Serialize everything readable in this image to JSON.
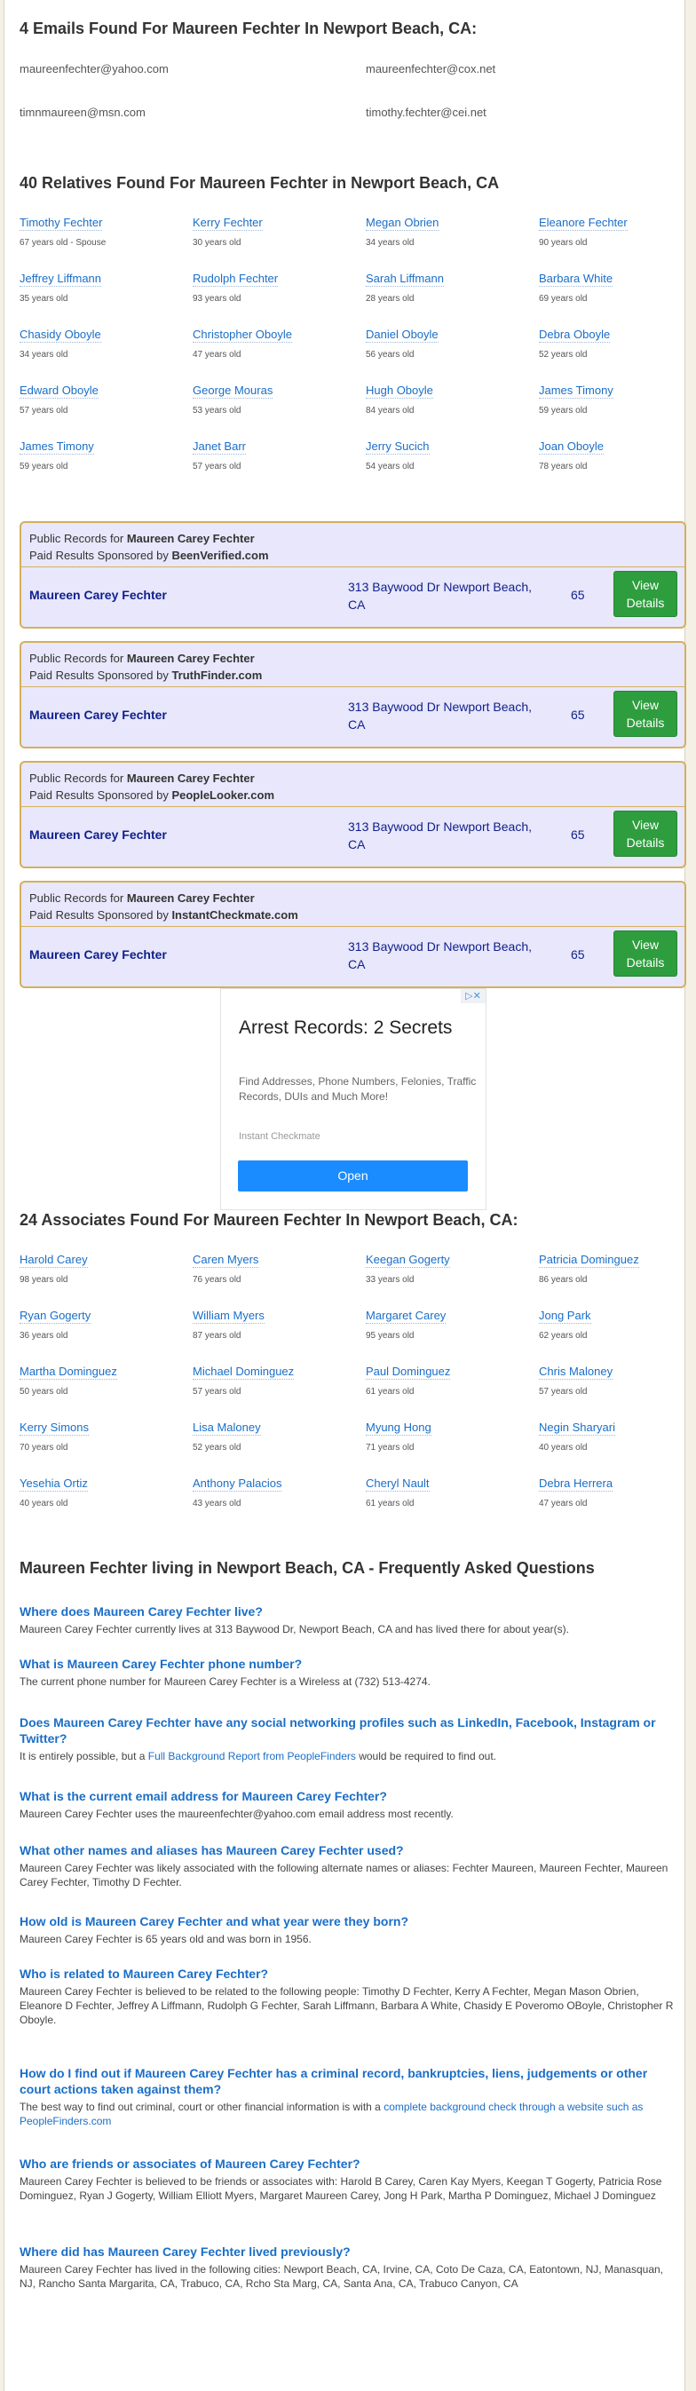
{
  "emails": {
    "heading": "4 Emails Found For Maureen Fechter In Newport Beach, CA:",
    "items": [
      "maureenfechter@yahoo.com",
      "maureenfechter@cox.net",
      "timnmaureen@msn.com",
      "timothy.fechter@cei.net"
    ]
  },
  "relatives": {
    "heading": "40 Relatives Found For Maureen Fechter in Newport Beach, CA",
    "items": [
      {
        "name": "Timothy Fechter",
        "age": "67 years old - Spouse"
      },
      {
        "name": "Kerry Fechter",
        "age": "30 years old"
      },
      {
        "name": "Megan Obrien",
        "age": "34 years old"
      },
      {
        "name": "Eleanore Fechter",
        "age": "90 years old"
      },
      {
        "name": "Jeffrey Liffmann",
        "age": "35 years old"
      },
      {
        "name": "Rudolph Fechter",
        "age": "93 years old"
      },
      {
        "name": "Sarah Liffmann",
        "age": "28 years old"
      },
      {
        "name": "Barbara White",
        "age": "69 years old"
      },
      {
        "name": "Chasidy Oboyle",
        "age": "34 years old"
      },
      {
        "name": "Christopher Oboyle",
        "age": "47 years old"
      },
      {
        "name": "Daniel Oboyle",
        "age": "56 years old"
      },
      {
        "name": "Debra Oboyle",
        "age": "52 years old"
      },
      {
        "name": "Edward Oboyle",
        "age": "57 years old"
      },
      {
        "name": "George Mouras",
        "age": "53 years old"
      },
      {
        "name": "Hugh Oboyle",
        "age": "84 years old"
      },
      {
        "name": "James Timony",
        "age": "59 years old"
      },
      {
        "name": "James Timony",
        "age": "59 years old"
      },
      {
        "name": "Janet Barr",
        "age": "57 years old"
      },
      {
        "name": "Jerry Sucich",
        "age": "54 years old"
      },
      {
        "name": "Joan Oboyle",
        "age": "78 years old"
      }
    ]
  },
  "public_records": [
    {
      "label": "Public Records for",
      "person": "Maureen Carey Fechter",
      "sponsor_label": "Paid Results Sponsored by",
      "sponsor": "BeenVerified.com",
      "name": "Maureen Carey Fechter",
      "address": "313 Baywood Dr Newport Beach, CA",
      "age": "65",
      "button": "View Details"
    },
    {
      "label": "Public Records for",
      "person": "Maureen Carey Fechter",
      "sponsor_label": "Paid Results Sponsored by",
      "sponsor": "TruthFinder.com",
      "name": "Maureen Carey Fechter",
      "address": "313 Baywood Dr Newport Beach, CA",
      "age": "65",
      "button": "View Details"
    },
    {
      "label": "Public Records for",
      "person": "Maureen Carey Fechter",
      "sponsor_label": "Paid Results Sponsored by",
      "sponsor": "PeopleLooker.com",
      "name": "Maureen Carey Fechter",
      "address": "313 Baywood Dr Newport Beach, CA",
      "age": "65",
      "button": "View Details"
    },
    {
      "label": "Public Records for",
      "person": "Maureen Carey Fechter",
      "sponsor_label": "Paid Results Sponsored by",
      "sponsor": "InstantCheckmate.com",
      "name": "Maureen Carey Fechter",
      "address": "313 Baywood Dr Newport Beach, CA",
      "age": "65",
      "button": "View Details"
    }
  ],
  "ad": {
    "title": "Arrest Records: 2 Secrets",
    "body": "Find Addresses, Phone Numbers, Felonies, Traffic Records, DUIs and Much More!",
    "source": "Instant Checkmate",
    "button": "Open",
    "close_glyph": "▷✕"
  },
  "associates": {
    "heading": "24 Associates Found For Maureen Fechter In Newport Beach, CA:",
    "items": [
      {
        "name": "Harold Carey",
        "age": "98 years old"
      },
      {
        "name": "Caren Myers",
        "age": "76 years old"
      },
      {
        "name": "Keegan Gogerty",
        "age": "33 years old"
      },
      {
        "name": "Patricia Dominguez",
        "age": "86 years old"
      },
      {
        "name": "Ryan Gogerty",
        "age": "36 years old"
      },
      {
        "name": "William Myers",
        "age": "87 years old"
      },
      {
        "name": "Margaret Carey",
        "age": "95 years old"
      },
      {
        "name": "Jong Park",
        "age": "62 years old"
      },
      {
        "name": "Martha Dominguez",
        "age": "50 years old"
      },
      {
        "name": "Michael Dominguez",
        "age": "57 years old"
      },
      {
        "name": "Paul Dominguez",
        "age": "61 years old"
      },
      {
        "name": "Chris Maloney",
        "age": "57 years old"
      },
      {
        "name": "Kerry Simons",
        "age": "70 years old"
      },
      {
        "name": "Lisa Maloney",
        "age": "52 years old"
      },
      {
        "name": "Myung Hong",
        "age": "71 years old"
      },
      {
        "name": "Negin Sharyari",
        "age": "40 years old"
      },
      {
        "name": "Yesehia Ortiz",
        "age": "40 years old"
      },
      {
        "name": "Anthony Palacios",
        "age": "43 years old"
      },
      {
        "name": "Cheryl Nault",
        "age": "61 years old"
      },
      {
        "name": "Debra Herrera",
        "age": "47 years old"
      }
    ]
  },
  "faq": {
    "heading": "Maureen Fechter living in Newport Beach, CA - Frequently Asked Questions",
    "items": [
      {
        "q": "Where does Maureen Carey Fechter live?",
        "a": "Maureen Carey Fechter currently lives at 313 Baywood Dr, Newport Beach, CA and has lived there for about year(s)."
      },
      {
        "q": "What is Maureen Carey Fechter phone number?",
        "a": "The current phone number for Maureen Carey Fechter is a Wireless at (732) 513-4274."
      },
      {
        "q": "Does Maureen Carey Fechter have any social networking profiles such as LinkedIn, Facebook, Instagram or Twitter?",
        "a": "It is entirely possible, but a",
        "a_link": "Full Background Report from PeopleFinders",
        "a_after": "would be required to find out."
      },
      {
        "q": "What is the current email address for Maureen Carey Fechter?",
        "a": "Maureen Carey Fechter uses the maureenfechter@yahoo.com email address most recently."
      },
      {
        "q": "What other names and aliases has Maureen Carey Fechter used?",
        "a": "Maureen Carey Fechter was likely associated with the following alternate names or aliases: Fechter Maureen, Maureen Fechter, Maureen Carey Fechter, Timothy D Fechter."
      },
      {
        "q": "How old is Maureen Carey Fechter and what year were they born?",
        "a": "Maureen Carey Fechter is 65 years old and was born in 1956."
      },
      {
        "q": "Who is related to Maureen Carey Fechter?",
        "a": "Maureen Carey Fechter is believed to be related to the following people: Timothy D Fechter, Kerry A Fechter, Megan Mason Obrien, Eleanore D Fechter, Jeffrey A Liffmann, Rudolph G Fechter, Sarah Liffmann, Barbara A White, Chasidy E Poveromo OBoyle, Christopher R Oboyle."
      },
      {
        "q": "How do I find out if Maureen Carey Fechter has a criminal record, bankruptcies, liens, judgements or other court actions taken against them?",
        "a": "The best way to find out criminal, court or other financial information is with a",
        "a_link": "complete background check through a website such as PeopleFinders.com"
      },
      {
        "q": "Who are friends or associates of Maureen Carey Fechter?",
        "a": "Maureen Carey Fechter is believed to be friends or associates with: Harold B Carey, Caren Kay Myers, Keegan T Gogerty, Patricia Rose Dominguez, Ryan J Gogerty, William Elliott Myers, Margaret Maureen Carey, Jong H Park, Martha P Dominguez, Michael J Dominguez"
      },
      {
        "q": "Where did has Maureen Carey Fechter lived previously?",
        "a": "Maureen Carey Fechter has lived in the following cities: Newport Beach, CA, Irvine, CA, Coto De Caza, CA, Eatontown, NJ, Manasquan, NJ, Rancho Santa Margarita, CA, Trabuco, CA, Rcho Sta Marg, CA, Santa Ana, CA, Trabuco Canyon, CA"
      }
    ]
  }
}
